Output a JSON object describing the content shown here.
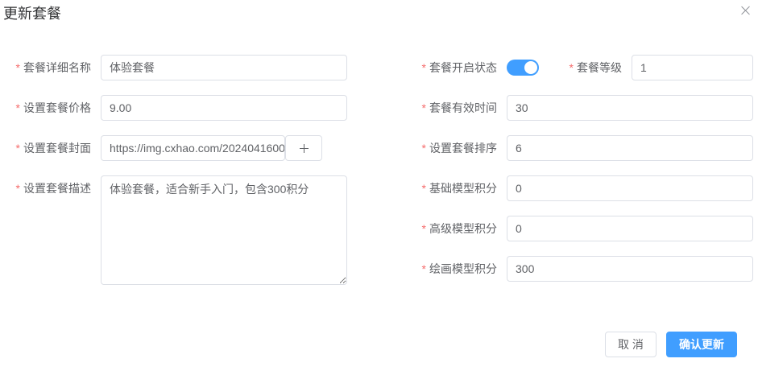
{
  "dialog": {
    "title": "更新套餐"
  },
  "required_mark": "*",
  "form": {
    "name": {
      "label": "套餐详细名称",
      "value": "体验套餐"
    },
    "price": {
      "label": "设置套餐价格",
      "value": "9.00"
    },
    "cover": {
      "label": "设置套餐封面",
      "value": "https://img.cxhao.com/2024041600"
    },
    "desc": {
      "label": "设置套餐描述",
      "value": "体验套餐，适合新手入门，包含300积分"
    },
    "status": {
      "label": "套餐开启状态",
      "enabled": true
    },
    "level": {
      "label": "套餐等级",
      "value": "1"
    },
    "validity": {
      "label": "套餐有效时间",
      "value": "30"
    },
    "sort": {
      "label": "设置套餐排序",
      "value": "6"
    },
    "basic_pts": {
      "label": "基础模型积分",
      "value": "0"
    },
    "adv_pts": {
      "label": "高级模型积分",
      "value": "0"
    },
    "draw_pts": {
      "label": "绘画模型积分",
      "value": "300"
    }
  },
  "footer": {
    "cancel_label": "取 消",
    "confirm_label": "确认更新"
  },
  "colors": {
    "primary": "#409eff",
    "required": "#f56c6c",
    "border": "#dcdfe6"
  }
}
